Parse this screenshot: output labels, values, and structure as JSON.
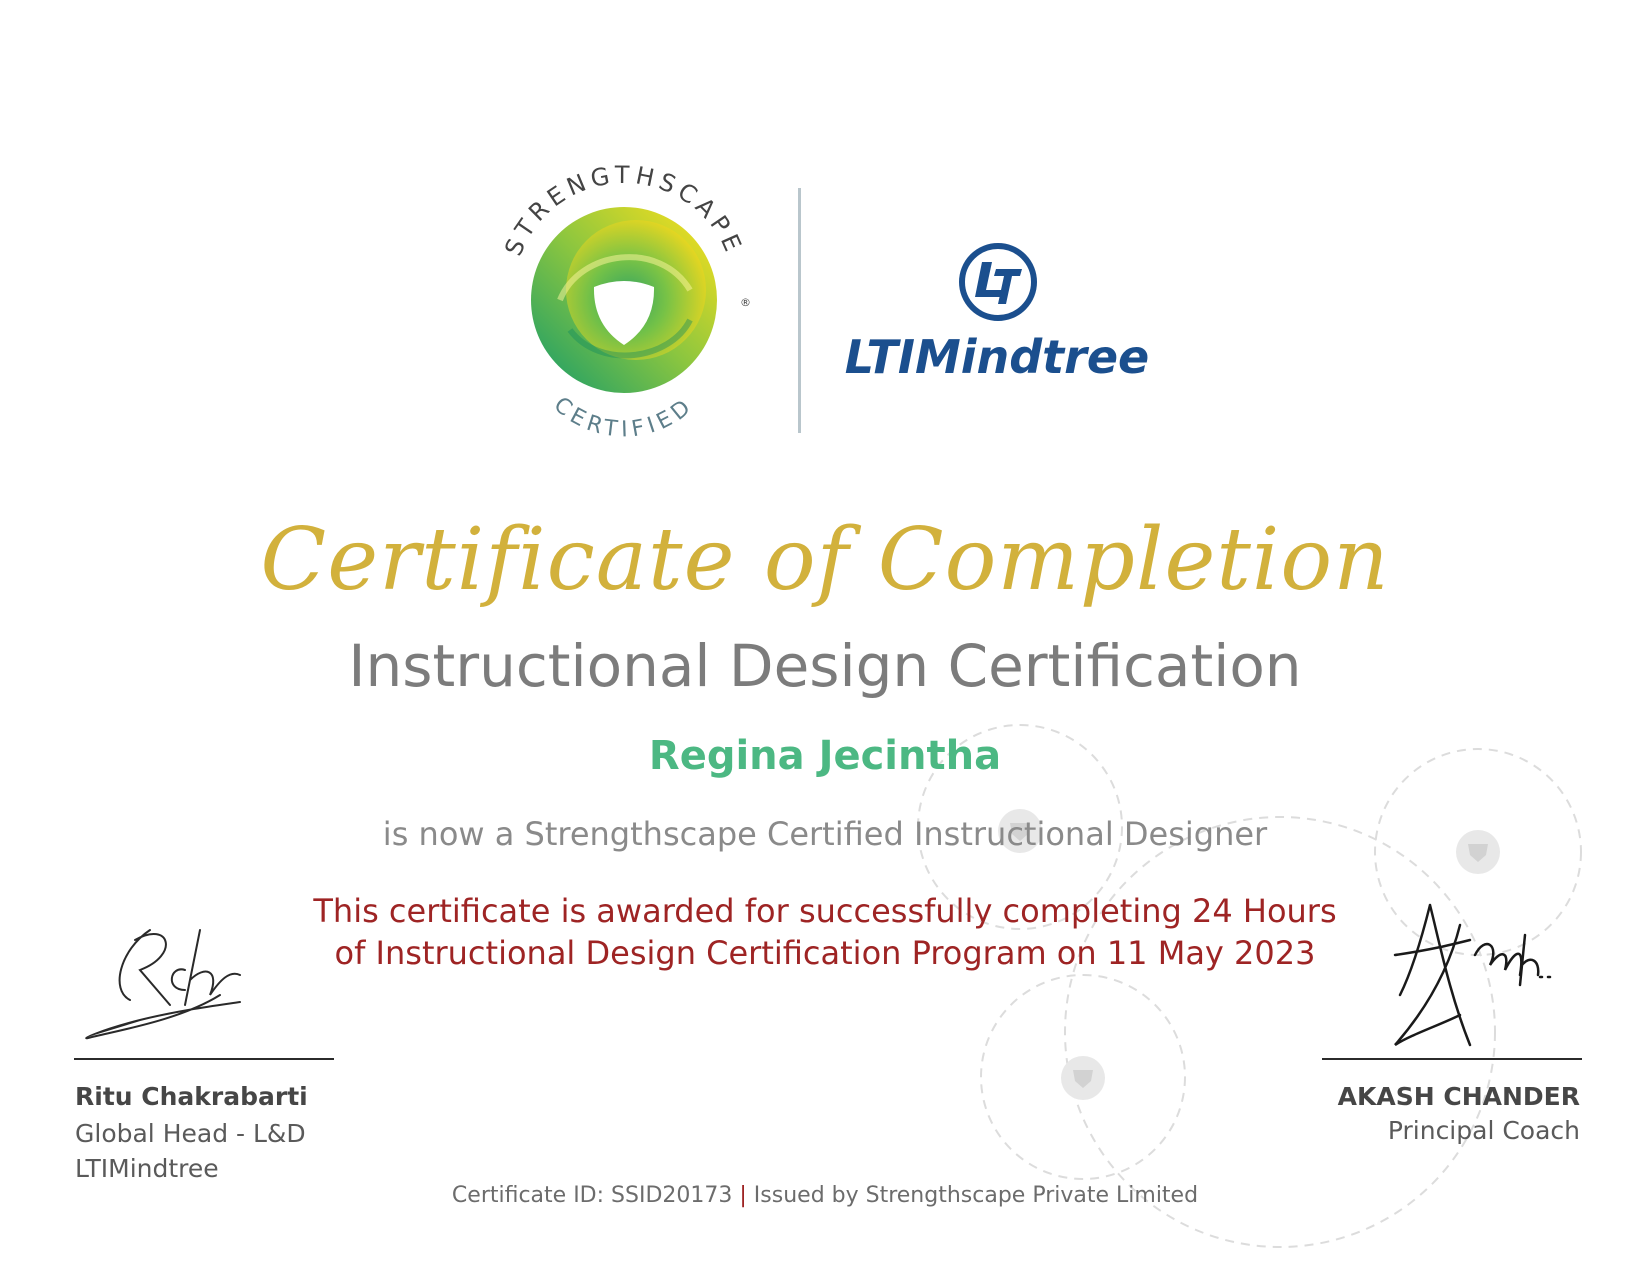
{
  "logos": {
    "left": {
      "arc_top": "STRENGTHSCAPE",
      "registered": "®",
      "arc_bottom": "CERTIFIED"
    },
    "right": {
      "name": "LTIMindtree"
    }
  },
  "certificate": {
    "title": "Certificate of Completion",
    "program": "Instructional Design Certification",
    "recipient": "Regina Jecintha",
    "statement": "is now a Strengthscape Certified Instructional Designer",
    "award_line_1": "This certificate is awarded for successfully completing 24 Hours",
    "award_line_2": "of Instructional Design Certification Program on 11 May 2023"
  },
  "signatories": {
    "left": {
      "name": "Ritu Chakrabarti",
      "role": "Global Head - L&D",
      "org": "LTIMindtree"
    },
    "right": {
      "name": "AKASH CHANDER",
      "role": "Principal Coach"
    }
  },
  "footer": {
    "certificate_id": "Certificate ID: SSID20173",
    "separator": "|",
    "issued_by": "Issued by Strengthscape Private Limited"
  },
  "colors": {
    "title_gold": "#d2b13c",
    "recipient_green": "#4cb883",
    "award_red": "#9e2424",
    "brand_blue": "#1b4f8e"
  }
}
